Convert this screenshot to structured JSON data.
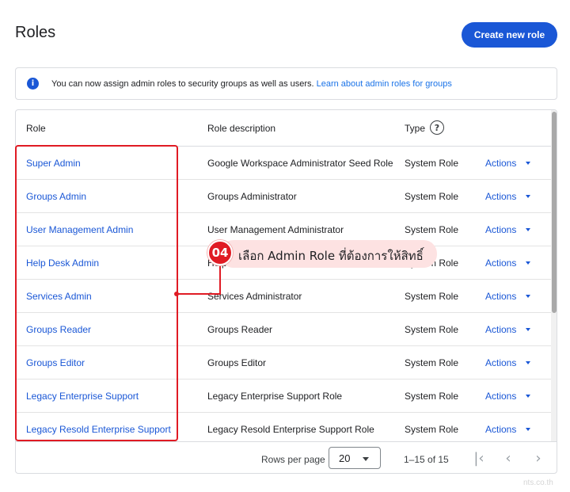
{
  "page": {
    "title": "Roles",
    "create_button": "Create new role"
  },
  "banner": {
    "icon": "info-icon",
    "icon_glyph": "i",
    "text": "You can now assign admin roles to security groups as well as users.",
    "link": "Learn about admin roles for groups"
  },
  "table": {
    "headers": {
      "role": "Role",
      "description": "Role description",
      "type": "Type",
      "help_glyph": "?"
    },
    "rows": [
      {
        "role": "Super Admin",
        "description": "Google Workspace Administrator Seed Role",
        "type": "System Role",
        "actions": "Actions"
      },
      {
        "role": "Groups Admin",
        "description": "Groups Administrator",
        "type": "System Role",
        "actions": "Actions"
      },
      {
        "role": "User Management Admin",
        "description": "User Management Administrator",
        "type": "System Role",
        "actions": "Actions"
      },
      {
        "role": "Help Desk Admin",
        "description": "Help Desk Administrator",
        "type": "System Role",
        "actions": "Actions"
      },
      {
        "role": "Services Admin",
        "description": "Services Administrator",
        "type": "System Role",
        "actions": "Actions"
      },
      {
        "role": "Groups Reader",
        "description": "Groups Reader",
        "type": "System Role",
        "actions": "Actions"
      },
      {
        "role": "Groups Editor",
        "description": "Groups Editor",
        "type": "System Role",
        "actions": "Actions"
      },
      {
        "role": "Legacy Enterprise Support",
        "description": "Legacy Enterprise Support Role",
        "type": "System Role",
        "actions": "Actions"
      },
      {
        "role": "Legacy Resold Enterprise Support",
        "description": "Legacy Resold Enterprise Support Role",
        "type": "System Role",
        "actions": "Actions"
      }
    ]
  },
  "pagination": {
    "rows_per_page_label": "Rows per page",
    "rows_per_page_value": "20",
    "range": "1–15 of 15",
    "first_glyph": "|‹",
    "prev_glyph": "‹",
    "next_glyph": "›"
  },
  "annotation": {
    "step": "04",
    "text": "เลือก Admin Role ที่ต้องการให้สิทธิ์",
    "color": "#e01b24"
  },
  "watermark": "nts.co.th",
  "colors": {
    "primary": "#1a57d6",
    "link": "#1a73e8",
    "annotation": "#e01b24"
  }
}
